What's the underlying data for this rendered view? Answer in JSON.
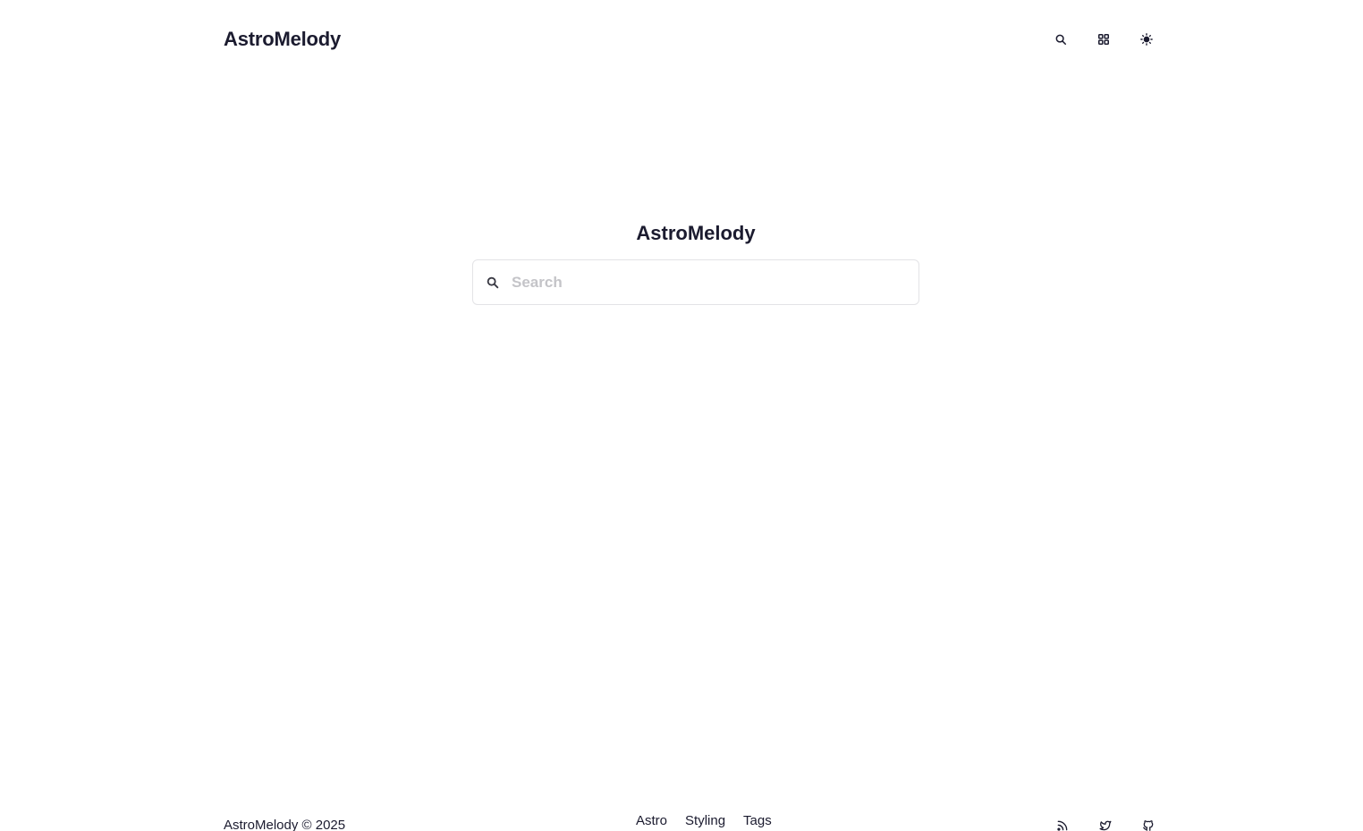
{
  "header": {
    "brand": "AstroMelody",
    "actions": [
      {
        "icon": "search-icon"
      },
      {
        "icon": "grid-icon"
      },
      {
        "icon": "sun-icon"
      }
    ]
  },
  "main": {
    "title": "AstroMelody",
    "search": {
      "placeholder": "Search",
      "value": ""
    }
  },
  "footer": {
    "copyright": "AstroMelody © 2025",
    "links": [
      "Astro",
      "Styling",
      "Tags"
    ],
    "social": [
      {
        "icon": "rss-icon"
      },
      {
        "icon": "twitter-icon"
      },
      {
        "icon": "github-icon"
      }
    ]
  }
}
